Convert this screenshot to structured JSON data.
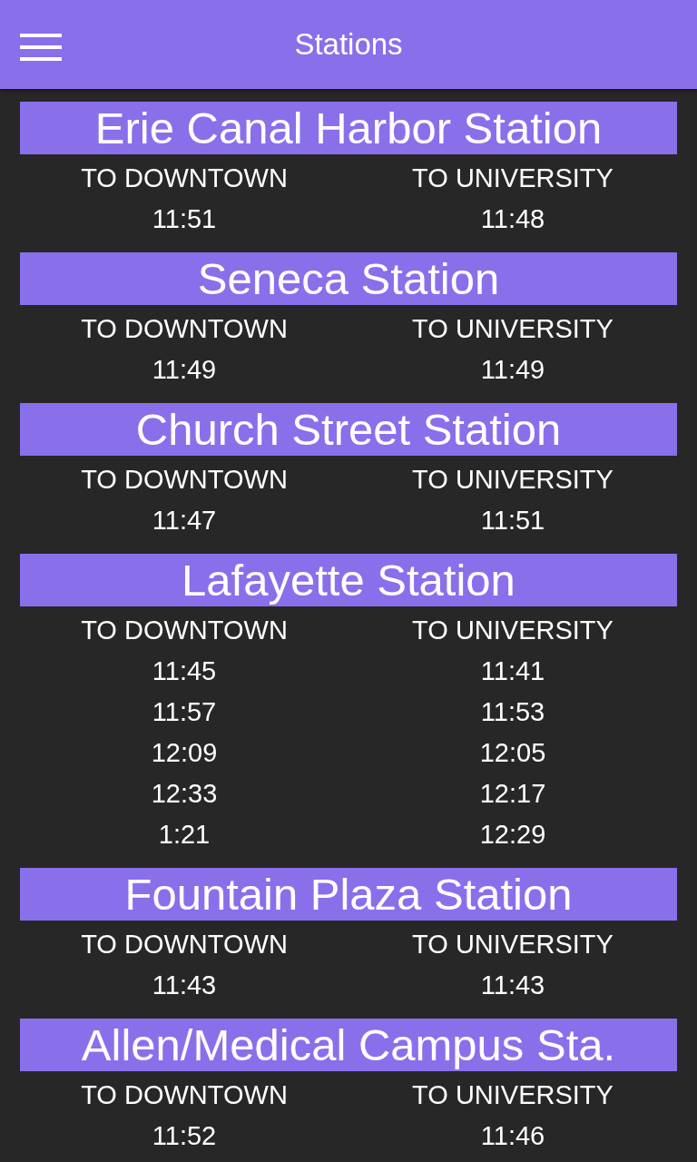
{
  "app_bar": {
    "title": "Stations"
  },
  "stations": [
    {
      "name": "Erie Canal Harbor Station",
      "columns": [
        {
          "label": "TO DOWNTOWN",
          "times": [
            "11:51"
          ]
        },
        {
          "label": "TO UNIVERSITY",
          "times": [
            "11:48"
          ]
        }
      ]
    },
    {
      "name": "Seneca Station",
      "columns": [
        {
          "label": "TO DOWNTOWN",
          "times": [
            "11:49"
          ]
        },
        {
          "label": "TO UNIVERSITY",
          "times": [
            "11:49"
          ]
        }
      ]
    },
    {
      "name": "Church Street Station",
      "columns": [
        {
          "label": "TO DOWNTOWN",
          "times": [
            "11:47"
          ]
        },
        {
          "label": "TO UNIVERSITY",
          "times": [
            "11:51"
          ]
        }
      ]
    },
    {
      "name": "Lafayette Station",
      "columns": [
        {
          "label": "TO DOWNTOWN",
          "times": [
            "11:45",
            "11:57",
            "12:09",
            "12:33",
            "1:21"
          ]
        },
        {
          "label": "TO UNIVERSITY",
          "times": [
            "11:41",
            "11:53",
            "12:05",
            "12:17",
            "12:29"
          ]
        }
      ]
    },
    {
      "name": "Fountain Plaza Station",
      "columns": [
        {
          "label": "TO DOWNTOWN",
          "times": [
            "11:43"
          ]
        },
        {
          "label": "TO UNIVERSITY",
          "times": [
            "11:43"
          ]
        }
      ]
    },
    {
      "name": "Allen/Medical Campus Sta.",
      "columns": [
        {
          "label": "TO DOWNTOWN",
          "times": [
            "11:52"
          ]
        },
        {
          "label": "TO UNIVERSITY",
          "times": [
            "11:46"
          ]
        }
      ]
    }
  ]
}
